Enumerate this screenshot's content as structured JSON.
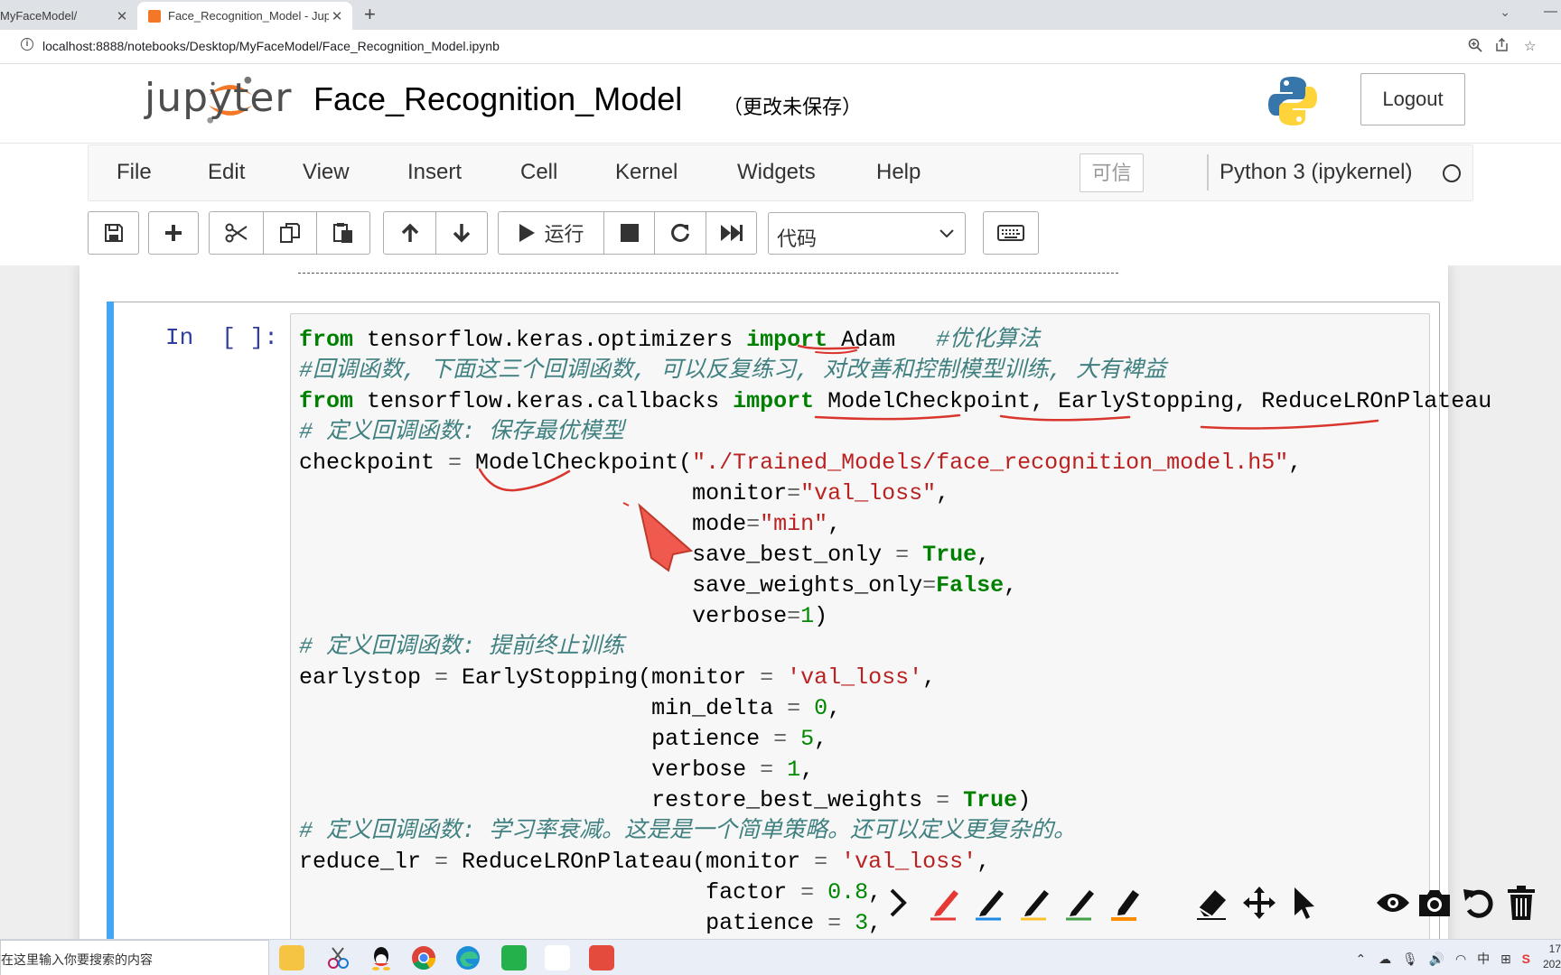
{
  "browser": {
    "tabs": [
      {
        "title": "MyFaceModel/",
        "active": false
      },
      {
        "title": "Face_Recognition_Model - Jup",
        "active": true
      }
    ],
    "new_tab_label": "+",
    "url": "localhost:8888/notebooks/Desktop/MyFaceModel/Face_Recognition_Model.ipynb"
  },
  "header": {
    "logo_text": "jupyter",
    "notebook_name": "Face_Recognition_Model",
    "save_status": "（更改未保存）",
    "logout_label": "Logout"
  },
  "menubar": {
    "items": [
      "File",
      "Edit",
      "View",
      "Insert",
      "Cell",
      "Kernel",
      "Widgets",
      "Help"
    ],
    "trusted_label": "可信",
    "kernel_name": "Python 3 (ipykernel)"
  },
  "toolbar": {
    "run_label": "运行",
    "cell_type": "代码"
  },
  "cell": {
    "prompt": "In  [ ]:",
    "code_lines": [
      "from tensorflow.keras.optimizers import Adam   #优化算法",
      "#回调函数, 下面这三个回调函数, 可以反复练习, 对改善和控制模型训练, 大有裨益",
      "from tensorflow.keras.callbacks import ModelCheckpoint, EarlyStopping, ReduceLROnPlateau",
      "# 定义回调函数: 保存最优模型",
      "checkpoint = ModelCheckpoint(\"./Trained_Models/face_recognition_model.h5\",",
      "                             monitor=\"val_loss\",",
      "                             mode=\"min\",",
      "                             save_best_only = True,",
      "                             save_weights_only=False,",
      "                             verbose=1)",
      "# 定义回调函数: 提前终止训练",
      "earlystop = EarlyStopping(monitor = 'val_loss',",
      "                          min_delta = 0,",
      "                          patience = 5,",
      "                          verbose = 1,",
      "                          restore_best_weights = True)",
      "# 定义回调函数: 学习率衰减。这是是一个简单策略。还可以定义更复杂的。",
      "reduce_lr = ReduceLROnPlateau(monitor = 'val_loss',",
      "                              factor = 0.8,",
      "                              patience = 3,"
    ]
  },
  "taskbar": {
    "search_text": "在这里输入你要搜索的内容",
    "tray_lang": "中",
    "clock_time": "17",
    "clock_date": "202"
  },
  "colors": {
    "cell_selected_bar": "#42a5f5",
    "jupyter_orange": "#f37726",
    "annotation_red": "#d9372e"
  },
  "icons": {
    "drawing_tools": [
      "chevron-right-icon",
      "pen-red-icon",
      "pen-blue-icon",
      "pen-yellow-icon",
      "pen-green-icon",
      "highlighter-orange-icon",
      "eraser-icon",
      "move-icon",
      "pointer-icon",
      "eye-icon",
      "camera-icon",
      "undo-icon",
      "trash-icon"
    ]
  }
}
